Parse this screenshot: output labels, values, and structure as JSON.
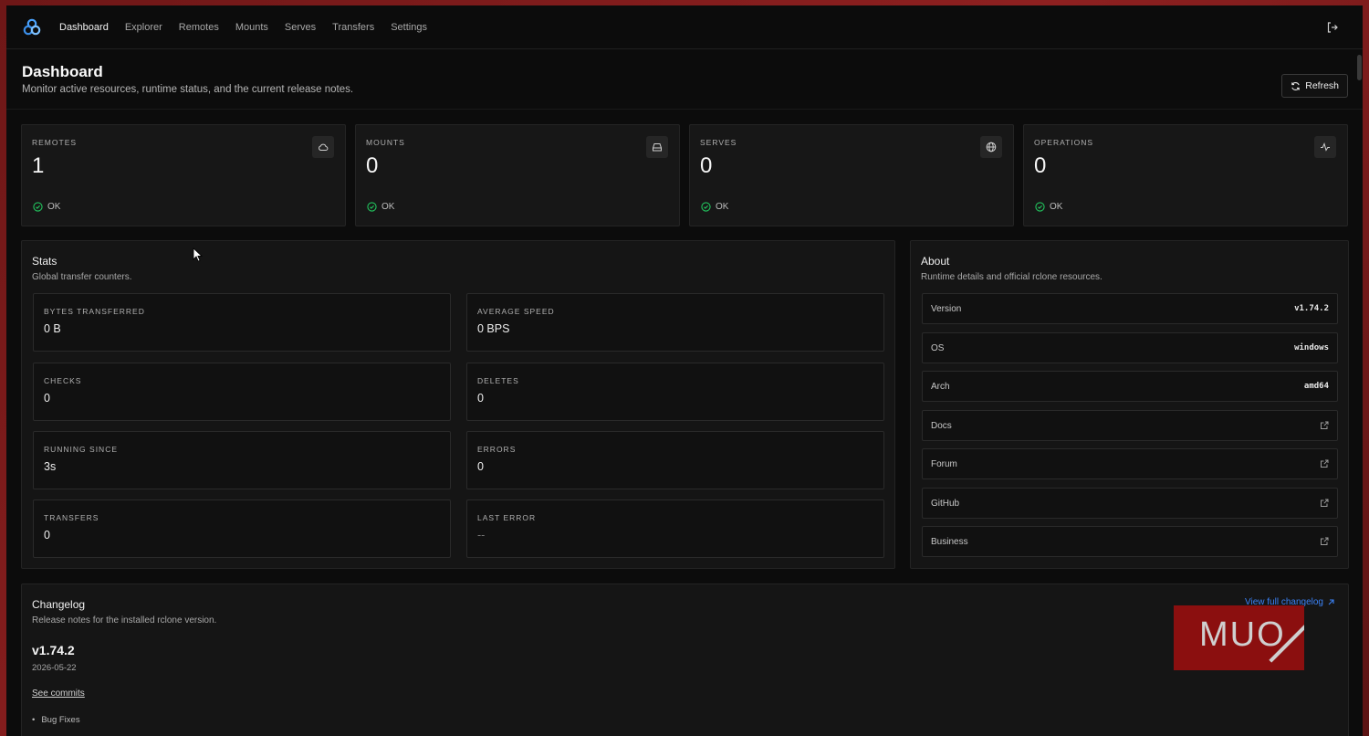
{
  "nav": {
    "items": [
      {
        "label": "Dashboard",
        "active": true
      },
      {
        "label": "Explorer"
      },
      {
        "label": "Remotes"
      },
      {
        "label": "Mounts"
      },
      {
        "label": "Serves"
      },
      {
        "label": "Transfers"
      },
      {
        "label": "Settings"
      }
    ],
    "logout_icon": "logout-icon"
  },
  "header": {
    "title": "Dashboard",
    "subtitle": "Monitor active resources, runtime status, and the current release notes.",
    "refresh_label": "Refresh"
  },
  "cards": [
    {
      "label": "REMOTES",
      "value": "1",
      "status": "OK",
      "icon": "cloud-icon"
    },
    {
      "label": "MOUNTS",
      "value": "0",
      "status": "OK",
      "icon": "drive-icon"
    },
    {
      "label": "SERVES",
      "value": "0",
      "status": "OK",
      "icon": "globe-icon"
    },
    {
      "label": "OPERATIONS",
      "value": "0",
      "status": "OK",
      "icon": "activity-icon"
    }
  ],
  "stats": {
    "title": "Stats",
    "subtitle": "Global transfer counters.",
    "items": [
      {
        "label": "BYTES TRANSFERRED",
        "value": "0 B"
      },
      {
        "label": "AVERAGE SPEED",
        "value": "0 BPS"
      },
      {
        "label": "CHECKS",
        "value": "0"
      },
      {
        "label": "DELETES",
        "value": "0"
      },
      {
        "label": "RUNNING SINCE",
        "value": "3s"
      },
      {
        "label": "ERRORS",
        "value": "0"
      },
      {
        "label": "TRANSFERS",
        "value": "0"
      },
      {
        "label": "LAST ERROR",
        "value": "--"
      }
    ]
  },
  "about": {
    "title": "About",
    "subtitle": "Runtime details and official rclone resources.",
    "rows": [
      {
        "label": "Version",
        "value": "v1.74.2"
      },
      {
        "label": "OS",
        "value": "windows"
      },
      {
        "label": "Arch",
        "value": "amd64"
      },
      {
        "label": "Docs",
        "link": true
      },
      {
        "label": "Forum",
        "link": true
      },
      {
        "label": "GitHub",
        "link": true
      },
      {
        "label": "Business",
        "link": true
      }
    ]
  },
  "changelog": {
    "title": "Changelog",
    "subtitle": "Release notes for the installed rclone version.",
    "view_link": "View full changelog",
    "version": "v1.74.2",
    "date": "2026-05-22",
    "commits_link": "See commits",
    "bullets": [
      "Bug Fixes"
    ]
  },
  "watermark": {
    "text": "MUO"
  },
  "colors": {
    "accent_link": "#3b82f6",
    "ok_green": "#22c55e",
    "watermark_red": "#8b0f0f"
  }
}
